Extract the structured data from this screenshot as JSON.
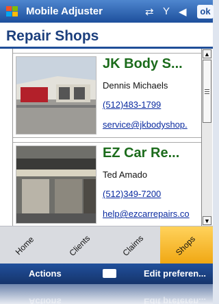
{
  "titlebar": {
    "app_name": "Mobile Adjuster",
    "ok_label": "ok"
  },
  "page": {
    "title": "Repair Shops"
  },
  "shops": [
    {
      "name": "JK Body S...",
      "contact": "Dennis Michaels",
      "phone": "(512)483-1799",
      "email": "service@jkbodyshop."
    },
    {
      "name": "EZ Car Re...",
      "contact": "Ted Amado",
      "phone": "(512)349-7200",
      "email": "help@ezcarrepairs.co"
    }
  ],
  "tabs": [
    {
      "label": "Home",
      "active": false
    },
    {
      "label": "Clients",
      "active": false
    },
    {
      "label": "Claims",
      "active": false
    },
    {
      "label": "Shops",
      "active": true
    }
  ],
  "menubar": {
    "left": "Actions",
    "right": "Edit preferen..."
  },
  "colors": {
    "title_bar": "#1d4f9c",
    "shop_name": "#1b6b1b",
    "link": "#0a2aa0",
    "active_tab": "#f0a712"
  }
}
